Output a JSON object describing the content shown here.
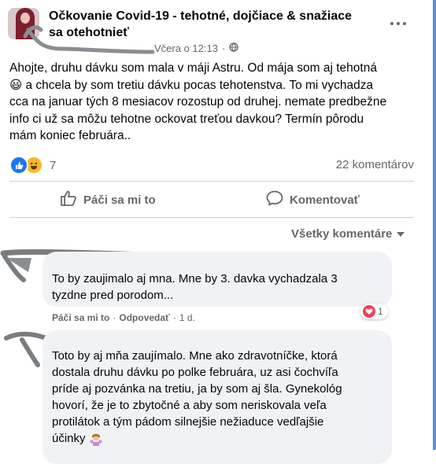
{
  "post": {
    "group_title": "Očkovanie Covid-19 - tehotné, dojčiace & snažiace sa otehotnieť",
    "timestamp": "Včera o 12:13",
    "separator": "·",
    "privacy_icon": "globe-icon",
    "body": "Ahojte, druhu dávku som mala v máji Astru. Od mája som aj tehotná\n😃 a chcela by som tretiu dávku pocas tehotenstva. To mi vychadza\ncca na januar tých 8 mesiacov rozostup od druhej. nemate predbežne\ninfo ci už sa môžu tehotne ockovat treťou davkou? Termín pôrodu\nmám koniec februára.."
  },
  "reactions": {
    "count": "7",
    "icons": [
      "like-icon",
      "haha-icon"
    ],
    "comments": "22 komentárov"
  },
  "actions": {
    "like": "Páči sa mi to",
    "comment": "Komentovať"
  },
  "sort": {
    "label": "Všetky komentáre"
  },
  "comments": [
    {
      "text": "To by zaujimalo aj mna. Mne by 3. davka vychadzala 3\ntyzdne pred porodom...",
      "like_label": "Páči sa mi to",
      "reply_label": "Odpovedať",
      "age": "1 d.",
      "separator": "·",
      "reaction_count": "1",
      "reaction_icon": "heart-icon"
    },
    {
      "text": "Toto by aj mňa zaujímalo. Mne ako zdravotníčke, ktorá\ndostala druhu dávku po polke februára, uz asi čochvíľa\npríde aj pozvánka na tretiu, ja by som aj šla. Gynekológ\nhovorí, že je to zbytočné a aby som neriskovala veľa\nprotilátok a tým pádom silnejšie nežiaduce vedľajšie\núčinky",
      "emoji_icon": "woman-shrugging-icon"
    }
  ],
  "colors": {
    "facebook_blue": "#1877f2",
    "secondary_text": "#65676b",
    "bubble_bg": "#f0f2f5",
    "divider": "#ced0d4",
    "heart": "#f33e58",
    "haha": "#f7b928"
  }
}
